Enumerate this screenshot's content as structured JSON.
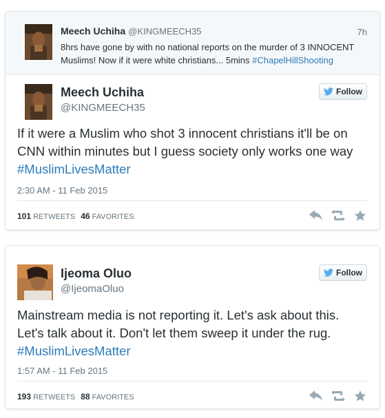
{
  "colors": {
    "accent": "#2b7bb9",
    "text": "#292f33",
    "muted": "#66757f",
    "icon": "#99aab5"
  },
  "tweet1": {
    "parent": {
      "name": "Meech Uchiha",
      "handle": "@KINGMEECH35",
      "time": "7h",
      "text_before": "8hrs have gone by with no national reports on the murder of 3 INNOCENT Muslims! Now if it were white christians... 5mins ",
      "hashtag": "#ChapelHillShooting"
    },
    "name": "Meech Uchiha",
    "handle": "@KINGMEECH35",
    "follow_label": "Follow",
    "text_before": "If it were a Muslim who shot 3 innocent christians it'll be on CNN within minutes but I guess society only works one way ",
    "hashtag": "#MuslimLivesMatter",
    "timestamp": "2:30 AM - 11 Feb 2015",
    "retweets_count": "101",
    "retweets_label": "RETWEETS",
    "favorites_count": "46",
    "favorites_label": "FAVORITES"
  },
  "tweet2": {
    "name": "Ijeoma Oluo",
    "handle": "@IjeomaOluo",
    "follow_label": "Follow",
    "text_before": "Mainstream media is not reporting it. Let's ask about this. Let's talk about it. Don't let them sweep it under the rug. ",
    "hashtag": "#MuslimLivesMatter",
    "timestamp": "1:57 AM - 11 Feb 2015",
    "retweets_count": "193",
    "retweets_label": "RETWEETS",
    "favorites_count": "88",
    "favorites_label": "FAVORITES"
  },
  "icons": [
    "reply-icon",
    "retweet-icon",
    "favorite-icon",
    "twitter-bird-icon"
  ]
}
